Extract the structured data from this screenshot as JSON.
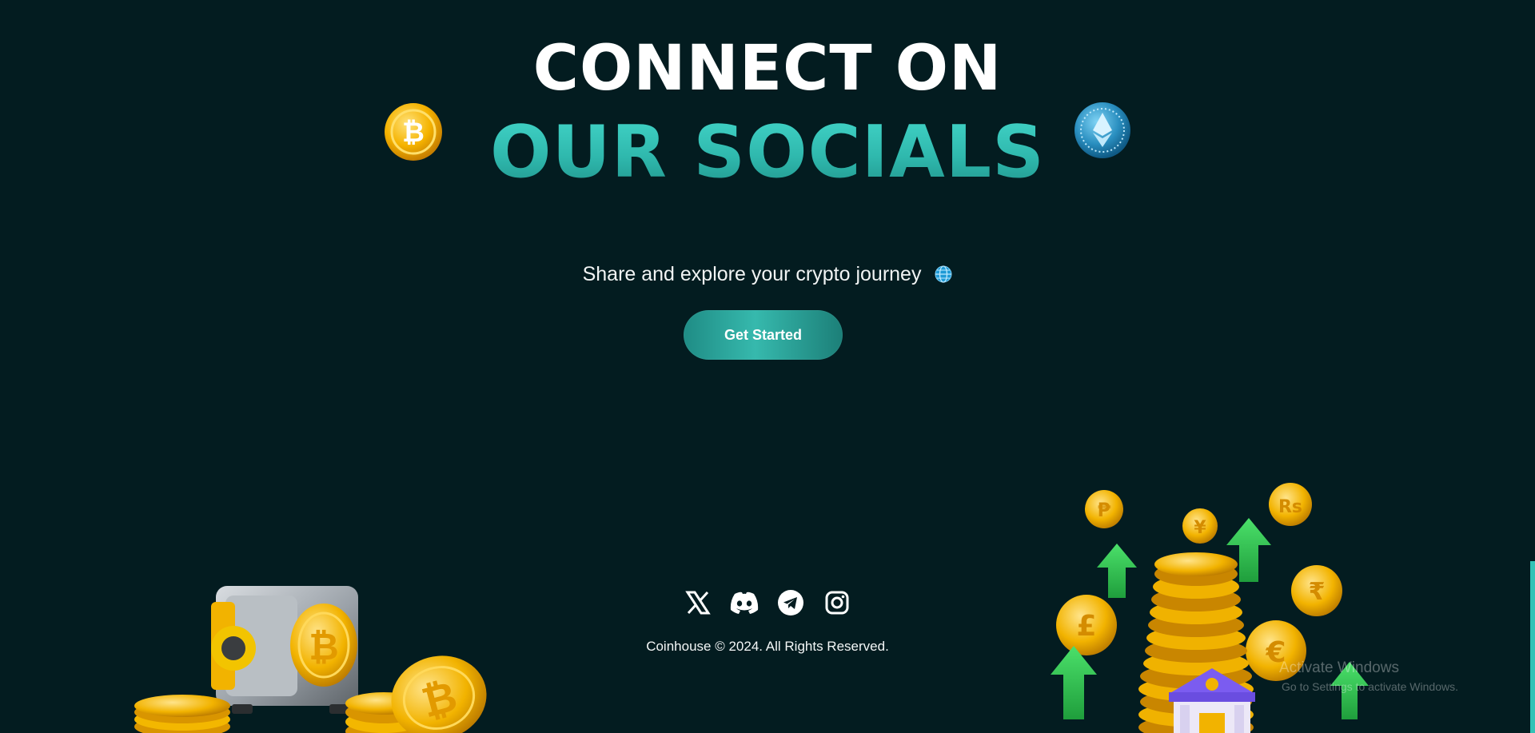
{
  "hero": {
    "title_line1": "CONNECT ON",
    "title_line2": "OUR SOCIALS",
    "subtitle": "Share and explore your crypto journey"
  },
  "cta": {
    "label": "Get Started"
  },
  "socials": [
    {
      "name": "x",
      "icon": "x-icon"
    },
    {
      "name": "discord",
      "icon": "discord-icon"
    },
    {
      "name": "telegram",
      "icon": "telegram-icon"
    },
    {
      "name": "instagram",
      "icon": "instagram-icon"
    }
  ],
  "footer": {
    "copyright": "Coinhouse © 2024. All Rights Reserved."
  },
  "watermark": {
    "title": "Activate Windows",
    "subtitle": "Go to Settings to activate Windows."
  },
  "colors": {
    "background": "#031c20",
    "accent": "#36b9ad",
    "coin_gold": "#f4b400",
    "arrow_green": "#2ecc55"
  }
}
